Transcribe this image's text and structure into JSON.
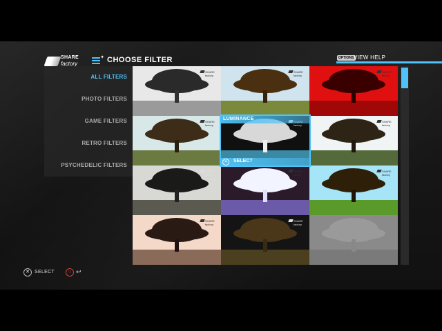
{
  "header": {
    "logo_line1": "SHARE",
    "logo_line2": "factory",
    "title": "CHOOSE FILTER",
    "options_badge": "OPTIONS",
    "help_label": "VIEW HELP"
  },
  "sidebar": {
    "items": [
      {
        "label": "ALL FILTERS",
        "active": true
      },
      {
        "label": "PHOTO FILTERS",
        "active": false
      },
      {
        "label": "GAME FILTERS",
        "active": false
      },
      {
        "label": "RETRO FILTERS",
        "active": false
      },
      {
        "label": "PSYCHEDELIC FILTERS",
        "active": false
      }
    ]
  },
  "grid": {
    "tiles": [
      {
        "name": "filter-grayscale",
        "sky": "#e8e8e8",
        "ground": "#9a9a9a",
        "canopy": "#2a2a2a",
        "trunk": "#333"
      },
      {
        "name": "filter-warm",
        "sky": "#cfe4ef",
        "ground": "#7a8a3a",
        "canopy": "#4a3010",
        "trunk": "#3a2308"
      },
      {
        "name": "filter-red",
        "sky": "#e01010",
        "ground": "#a00808",
        "canopy": "#3a0000",
        "trunk": "#2a0000"
      },
      {
        "name": "filter-faded",
        "sky": "#d8e8e8",
        "ground": "#6a7a40",
        "canopy": "#3c2c18",
        "trunk": "#2a2010"
      },
      {
        "name": "filter-luminance",
        "sky": "#101010",
        "ground": "#3a8aa6",
        "canopy": "#d8d8d8",
        "trunk": "#eee"
      },
      {
        "name": "filter-soft",
        "sky": "#f0f4f4",
        "ground": "#556a3a",
        "canopy": "#2e2416",
        "trunk": "#201810"
      },
      {
        "name": "filter-dark-mono",
        "sky": "#d8d8d4",
        "ground": "#5a5a50",
        "canopy": "#1a1a18",
        "trunk": "#222"
      },
      {
        "name": "filter-invert",
        "sky": "#2a1a2a",
        "ground": "#6a5aa8",
        "canopy": "#f2f4ff",
        "trunk": "#e0e0ff"
      },
      {
        "name": "filter-vivid",
        "sky": "#a6e4f8",
        "ground": "#5a9a2a",
        "canopy": "#2e2008",
        "trunk": "#201406"
      },
      {
        "name": "filter-sepia",
        "sky": "#f4d8c8",
        "ground": "#8a6a58",
        "canopy": "#2a1a14",
        "trunk": "#201210"
      },
      {
        "name": "filter-night",
        "sky": "#141414",
        "ground": "#4a4020",
        "canopy": "#4a3618",
        "trunk": "#3a2a10"
      },
      {
        "name": "filter-emboss",
        "sky": "#8a8a8a",
        "ground": "#7a7a7a",
        "canopy": "#9a9a9a",
        "trunk": "#888"
      }
    ],
    "selected_label": "LUMINANCE",
    "selected_action_icon": "✕",
    "selected_action": "SELECT"
  },
  "watermark": {
    "line1": "SHARE",
    "line2": "factory"
  },
  "footer": {
    "select_icon": "✕",
    "select_label": "SELECT",
    "back_icon": "○",
    "back_arrow": "↩"
  },
  "colors": {
    "accent": "#4fc3f7"
  }
}
